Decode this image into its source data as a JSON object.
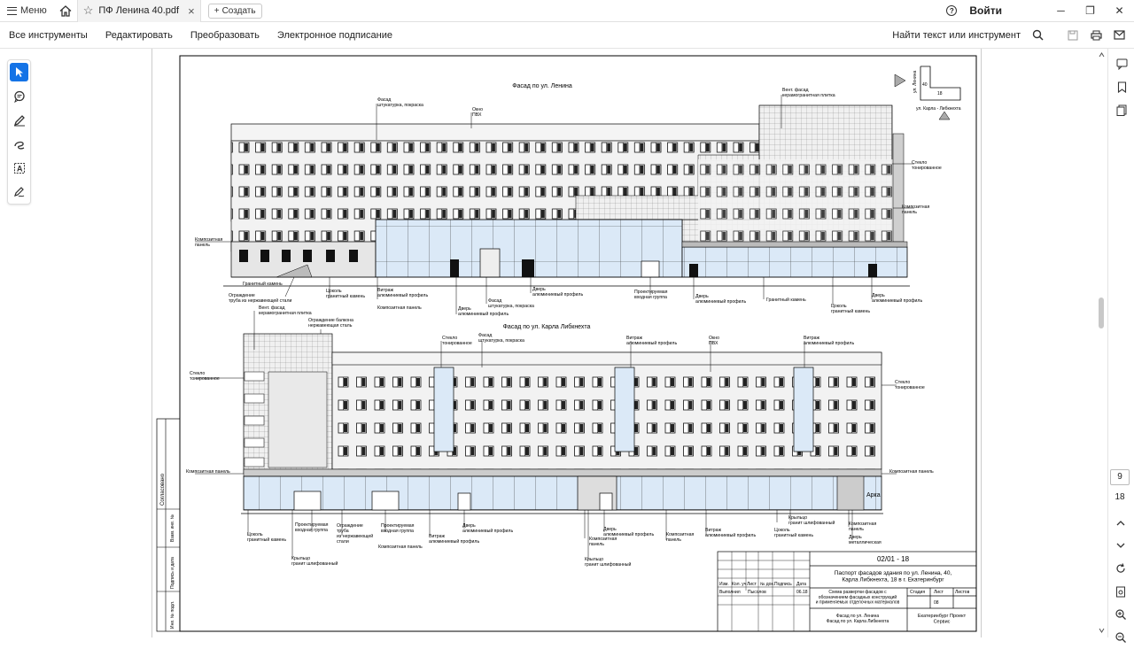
{
  "titlebar": {
    "menu_label": "Меню",
    "tab_title": "ПФ Ленина 40.pdf",
    "create_label": "Создать",
    "signin_label": "Войти"
  },
  "toolbar": {
    "items": [
      "Все инструменты",
      "Редактировать",
      "Преобразовать",
      "Электронное подписание"
    ],
    "find_label": "Найти текст или инструмент"
  },
  "pagination": {
    "current": "9",
    "total": "18"
  },
  "drawing": {
    "top_title": "Фасад по ул. Ленина",
    "bottom_title": "Фасад по ул. Карла Либкнехта",
    "labels_top": {
      "facade_plaster": "Фасад\nштукатурка, покраска",
      "window_pvc": "Окно\nПВХ",
      "vent_facade": "Вент. фасад\nкерамогранитная плитка",
      "tinted_glass": "Стекло\nтонированное",
      "composite_panel_r": "Композитная\nпанель",
      "composite_panel_l": "Композитная\nпанель",
      "granite_stone": "Гранитный камень",
      "fence": "Ограждение\nтруба из нержавеющей стали",
      "plinth": "Цоколь\nгранитный камень",
      "vitrage": "Витраж\nалюминиевый профиль",
      "composite_panel_b": "Композитная панель",
      "door_alu": "Дверь\nалюминиевый профиль",
      "facade_plaster_b": "Фасад\nштукатурка, покраска",
      "door_alu_2": "Дверь\nалюминиевый профиль",
      "entrance_group": "Проектируемая\nвходная группа",
      "door_alu_3": "Дверь\nалюминиевый профиль",
      "granite_stone_2": "Гранитный камень",
      "plinth_2": "Цоколь\nгранитный камень",
      "door_alu_4": "Дверь\nалюминиевый профиль"
    },
    "labels_bottom": {
      "vent_facade": "Вент. фасад\nкерамогранитная плитка",
      "balcony_fence": "Ограждение балкона\nнержавеющая сталь",
      "tinted_glass_top": "Стекло\nтонированное",
      "facade_plaster": "Фасад\nштукатурка, покраска",
      "vitrage_1": "Витраж\nалюминиевый профиль",
      "window_pvc": "Окно\nПВХ",
      "vitrage_2": "Витраж\nалюминиевый профиль",
      "tinted_glass_l": "Стекло\nтонированное",
      "tinted_glass_r": "Стекло\nтонированное",
      "composite_panel_l": "Композитная панель",
      "composite_panel_r": "Композитная панель",
      "arch": "Арка",
      "plinth": "Цоколь\nгранитный камень",
      "entrance_group_1": "Проектируемая\nвходная группа",
      "fence_pipe": "Ограждение\nтруба\nиз нержавеющей\nстали",
      "entrance_group_2": "Проектируемая\nвходная группа",
      "composite_panel_b": "Композитная панель",
      "vitrage_3": "Витраж\nалюминиевый профиль",
      "door_alu": "Дверь\nалюминиевый профиль",
      "porch_1": "Крыльцо\nгранит шлифованный",
      "composite_panel_c": "Композитная\nпанель",
      "door_alu_2": "Дверь\nалюминиевый профиль",
      "porch_2": "Крыльцо\nгранит шлифованный",
      "composite_panel_d": "Композитная\nпанель",
      "vitrage_4": "Витраж\nалюминиевый профиль",
      "plinth_2": "Цоколь\nгранитный камень",
      "porch_3": "Крыльцо\nгранит шлифованный",
      "composite_panel_e": "Композитная\nпанель",
      "door_metal": "Дверь\nметаллическая"
    },
    "keyplan": {
      "street_left": "ул. Ленина",
      "street_bottom": "ул. Карла - Либкнехта",
      "n40": "40",
      "n18": "18"
    },
    "side_stamps": [
      "Согласовано",
      "Взам. инв. №",
      "Подпись и дата",
      "Инв. № подл."
    ],
    "title_block": {
      "code": "02/01 - 18",
      "title": "Паспорт фасадов здания по ул. Ленина, 40,\nКарла Либкнехта, 18 в г. Екатеринбург",
      "subtitle": "Схема развертки фасадов с\nобозначением фасадных конструкций\nи применяемых отделочных материалов",
      "col_headers": [
        "Изм.",
        "Кол. уч",
        "Лист",
        "№ док.",
        "Подпись",
        "Дата"
      ],
      "row_labels": [
        "Выполнил",
        "Пысолов",
        "06.18"
      ],
      "stage_headers": [
        "Стадия",
        "Лист",
        "Листов"
      ],
      "stage_value": "08",
      "sheet_names": "Фасад по ул. Ленина\nФасад по ул. Карла Либкнехта",
      "company": "Екатеринбург Проект\nСервис"
    }
  }
}
